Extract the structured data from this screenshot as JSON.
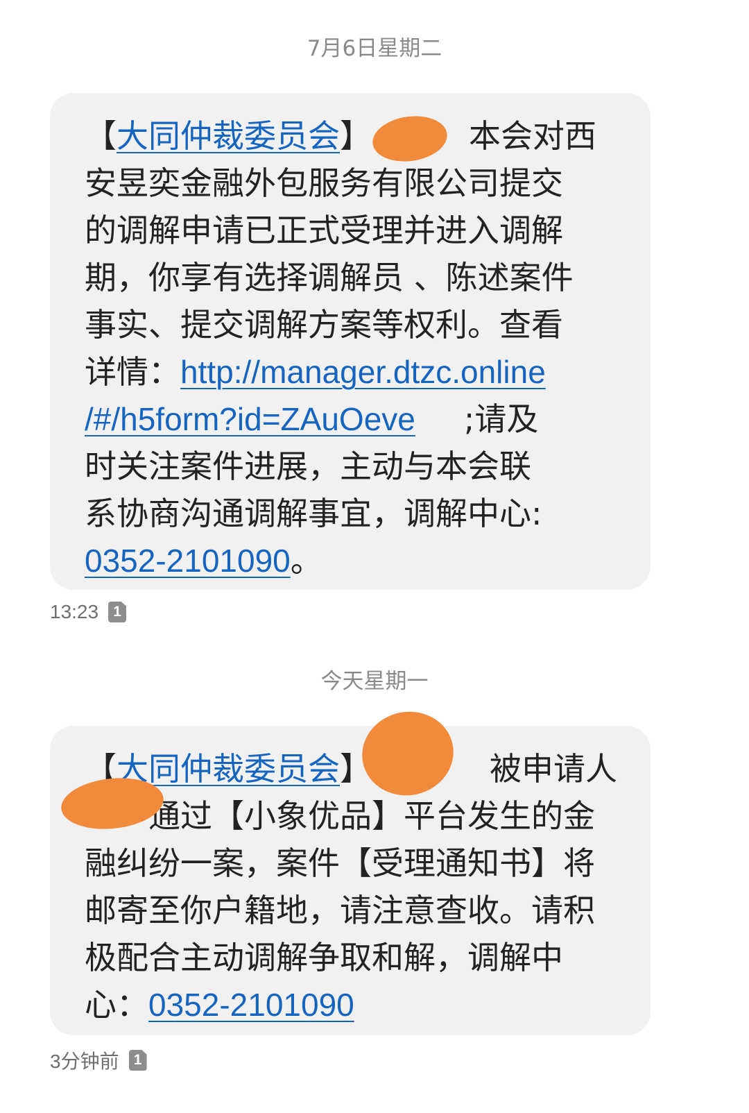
{
  "messages": [
    {
      "date_label": "7月6日星期二",
      "time": "13:23",
      "sim": "1",
      "line1": {
        "bracket_open": "【",
        "sender": "大同仲裁委员会",
        "bracket_close": "】",
        "tail": "本会对西"
      },
      "line2": "安昱奕金融外包服务有限公司提交",
      "line3": "的调解申请已正式受理并进入调解",
      "line4": "期，你享有选择调解员 、陈述案件",
      "line5": "事实、提交调解方案等权利。查看",
      "line6": {
        "prefix": "详情：",
        "url_part1": "http://manager.dtzc.online"
      },
      "line7": {
        "url_part2": "/#/h5form?id=ZAuOeve",
        "suffix": ";请及"
      },
      "line8": "时关注案件进展，主动与本会联",
      "line9": "系协商沟通调解事宜，调解中心:",
      "line10": {
        "phone": "0352-2101090",
        "end": "。"
      }
    },
    {
      "date_label": "今天星期一",
      "time": "3分钟前",
      "sim": "1",
      "line1": {
        "bracket_open": "【",
        "sender": "大同仲裁委员会",
        "bracket_close": "】",
        "tail": "被申请人"
      },
      "line2": {
        "lead": "",
        "text": "通过【小象优品】平台发生的金"
      },
      "line3": "融纠纷一案，案件【受理通知书】将",
      "line4": "邮寄至你户籍地，请注意查收。请积",
      "line5": "极配合主动调解争取和解，调解中",
      "line6": {
        "prefix": "心：",
        "phone": "0352-2101090"
      }
    }
  ],
  "colors": {
    "link": "#1565c0",
    "bubble": "#f1f1f1",
    "redaction": "#f28a3c",
    "meta_text": "#6f6f6f"
  }
}
